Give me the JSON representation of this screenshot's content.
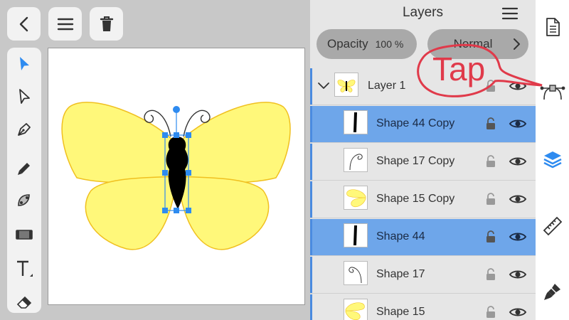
{
  "top_bar": {
    "back_icon": "chevron-left-icon",
    "menu_icon": "hamburger-icon",
    "delete_icon": "trash-icon"
  },
  "tools": [
    {
      "name": "select-tool",
      "icon": "arrow-filled-icon",
      "active": true
    },
    {
      "name": "direct-select-tool",
      "icon": "arrow-outline-icon"
    },
    {
      "name": "pen-tool",
      "icon": "pen-nib-icon"
    },
    {
      "name": "pencil-tool",
      "icon": "pencil-icon"
    },
    {
      "name": "node-tool",
      "icon": "curve-node-icon"
    },
    {
      "name": "fill-tool",
      "icon": "gradient-bar-icon"
    },
    {
      "name": "text-tool",
      "icon": "text-icon"
    },
    {
      "name": "eraser-tool",
      "icon": "eraser-icon"
    }
  ],
  "layers_panel": {
    "title": "Layers",
    "opacity_label": "Opacity",
    "opacity_value": "100 %",
    "blend_mode": "Normal",
    "rows": [
      {
        "label": "Layer 1",
        "type": "layer",
        "selected": false
      },
      {
        "label": "Shape 44 Copy",
        "type": "shape",
        "selected": true
      },
      {
        "label": "Shape 17 Copy",
        "type": "shape",
        "selected": false
      },
      {
        "label": "Shape 15 Copy",
        "type": "shape",
        "selected": false
      },
      {
        "label": "Shape 44",
        "type": "shape",
        "selected": true
      },
      {
        "label": "Shape 17",
        "type": "shape",
        "selected": false
      },
      {
        "label": "Shape 15",
        "type": "shape",
        "selected": false
      }
    ]
  },
  "sidebar": [
    {
      "name": "document-icon"
    },
    {
      "name": "vector-path-icon"
    },
    {
      "name": "layers-icon",
      "active": true
    },
    {
      "name": "ruler-icon"
    },
    {
      "name": "brush-icon"
    }
  ],
  "annotation": {
    "text": "Tap"
  },
  "colors": {
    "accent": "#2e8bf0",
    "selected_row": "#6ea6ea",
    "wing_fill": "#fff87a",
    "wing_stroke": "#f0c020",
    "callout": "#e03a4a"
  }
}
